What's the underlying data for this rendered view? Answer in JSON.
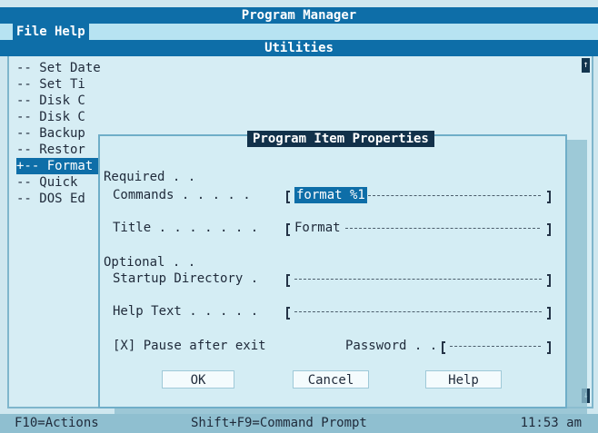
{
  "window": {
    "title": "Program Manager"
  },
  "menu": {
    "file": "File",
    "help": "Help"
  },
  "group": {
    "title": "Utilities"
  },
  "program_list": [
    "-- Set Date",
    "-- Set Ti",
    "-- Disk C",
    "-- Disk C",
    "-- Backup",
    "-- Restor",
    "+-- Format",
    "-- Quick",
    "-- DOS Ed"
  ],
  "dialog": {
    "title": "Program Item Properties",
    "required_label": "Required . .",
    "commands_label": "Commands . . . . .",
    "commands_value": "format %1",
    "title_label": "Title . . . . . . .",
    "title_value": "Format",
    "optional_label": "Optional . .",
    "startup_directory_label": "Startup Directory .",
    "startup_directory_value": "",
    "help_text_label": "Help Text . . . . .",
    "help_text_value": "",
    "pause_after_exit_label": "[X] Pause after exit",
    "password_label": "Password . .",
    "password_value": "",
    "ok_label": "OK",
    "cancel_label": "Cancel",
    "help_label": "Help"
  },
  "status": {
    "left": "F10=Actions",
    "middle": "Shift+F9=Command Prompt",
    "right": "11:53 am"
  },
  "colors": {
    "background": "#cfe7ef",
    "title_bar": "#0e6ea8",
    "dialog_title": "#12314a",
    "selected": "#0e6ea8"
  }
}
